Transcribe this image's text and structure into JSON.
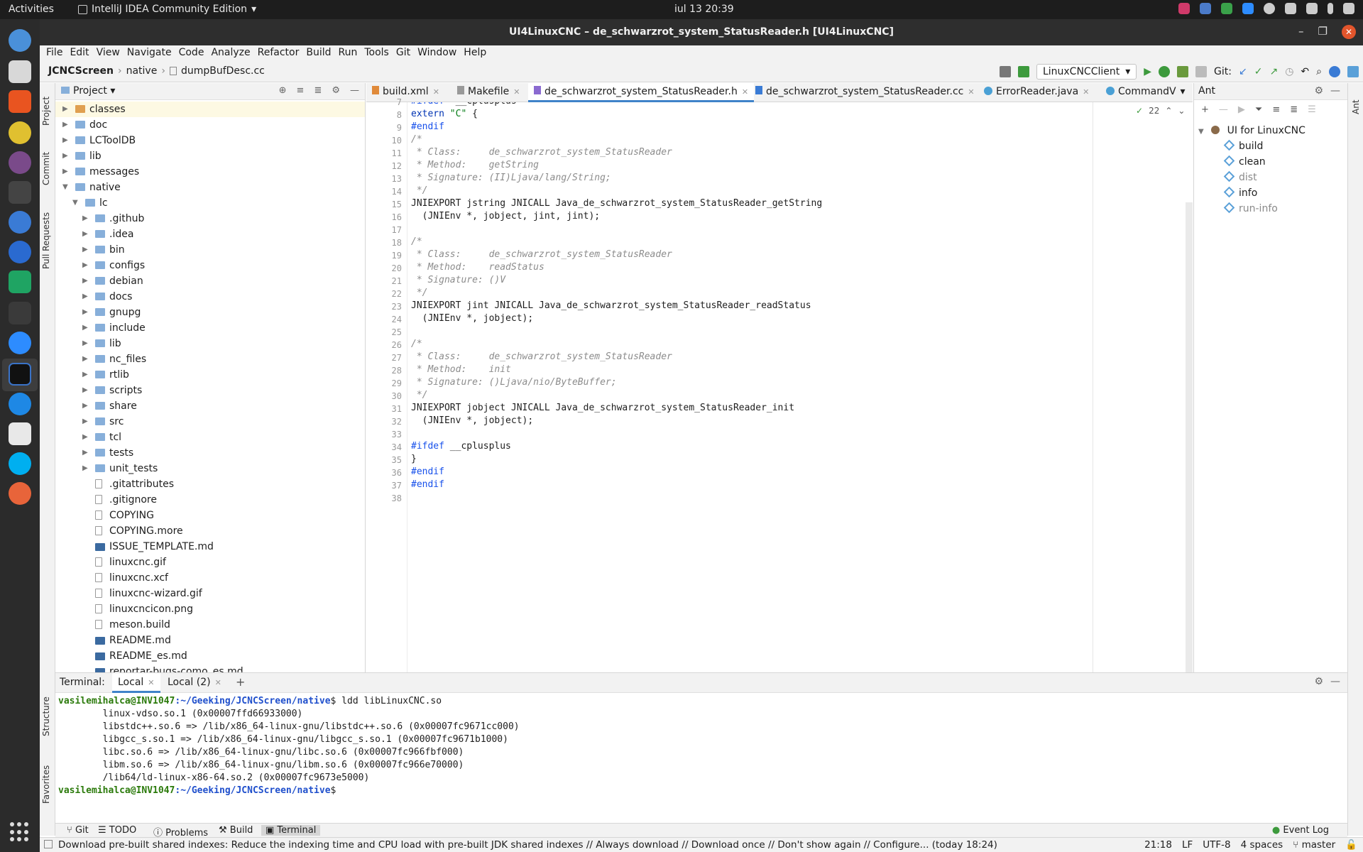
{
  "topbar": {
    "activities": "Activities",
    "app_name": "IntelliJ IDEA Community Edition",
    "clock": "iul 13  20:39"
  },
  "window": {
    "title": "UI4LinuxCNC – de_schwarzrot_system_StatusReader.h [UI4LinuxCNC]"
  },
  "menu": [
    "File",
    "Edit",
    "View",
    "Navigate",
    "Code",
    "Analyze",
    "Refactor",
    "Build",
    "Run",
    "Tools",
    "Git",
    "Window",
    "Help"
  ],
  "breadcrumb": [
    "JCNCScreen",
    "native",
    "dumpBufDesc.cc"
  ],
  "toolbar": {
    "run_config": "LinuxCNCClient",
    "git_label": "Git:"
  },
  "left_strip": [
    "Project",
    "Commit",
    "Pull Requests",
    "Structure",
    "Favorites"
  ],
  "project": {
    "title": "Project",
    "tree": [
      {
        "label": "classes",
        "depth": 1,
        "type": "folder-orange",
        "arrow": "right",
        "selected": true
      },
      {
        "label": "doc",
        "depth": 1,
        "type": "folder",
        "arrow": "right"
      },
      {
        "label": "LCToolDB",
        "depth": 1,
        "type": "folder",
        "arrow": "right"
      },
      {
        "label": "lib",
        "depth": 1,
        "type": "folder",
        "arrow": "right"
      },
      {
        "label": "messages",
        "depth": 1,
        "type": "folder",
        "arrow": "right"
      },
      {
        "label": "native",
        "depth": 1,
        "type": "folder",
        "arrow": "down"
      },
      {
        "label": "lc",
        "depth": 2,
        "type": "folder",
        "arrow": "down"
      },
      {
        "label": ".github",
        "depth": 3,
        "type": "folder",
        "arrow": "right"
      },
      {
        "label": ".idea",
        "depth": 3,
        "type": "folder",
        "arrow": "right"
      },
      {
        "label": "bin",
        "depth": 3,
        "type": "folder",
        "arrow": "right"
      },
      {
        "label": "configs",
        "depth": 3,
        "type": "folder",
        "arrow": "right"
      },
      {
        "label": "debian",
        "depth": 3,
        "type": "folder",
        "arrow": "right"
      },
      {
        "label": "docs",
        "depth": 3,
        "type": "folder",
        "arrow": "right"
      },
      {
        "label": "gnupg",
        "depth": 3,
        "type": "folder",
        "arrow": "right"
      },
      {
        "label": "include",
        "depth": 3,
        "type": "folder",
        "arrow": "right"
      },
      {
        "label": "lib",
        "depth": 3,
        "type": "folder",
        "arrow": "right"
      },
      {
        "label": "nc_files",
        "depth": 3,
        "type": "folder",
        "arrow": "right"
      },
      {
        "label": "rtlib",
        "depth": 3,
        "type": "folder",
        "arrow": "right"
      },
      {
        "label": "scripts",
        "depth": 3,
        "type": "folder",
        "arrow": "right"
      },
      {
        "label": "share",
        "depth": 3,
        "type": "folder",
        "arrow": "right"
      },
      {
        "label": "src",
        "depth": 3,
        "type": "folder",
        "arrow": "right"
      },
      {
        "label": "tcl",
        "depth": 3,
        "type": "folder",
        "arrow": "right"
      },
      {
        "label": "tests",
        "depth": 3,
        "type": "folder",
        "arrow": "right"
      },
      {
        "label": "unit_tests",
        "depth": 3,
        "type": "folder",
        "arrow": "right"
      },
      {
        "label": ".gitattributes",
        "depth": 3,
        "type": "file",
        "arrow": ""
      },
      {
        "label": ".gitignore",
        "depth": 3,
        "type": "file",
        "arrow": ""
      },
      {
        "label": "COPYING",
        "depth": 3,
        "type": "file",
        "arrow": ""
      },
      {
        "label": "COPYING.more",
        "depth": 3,
        "type": "file",
        "arrow": ""
      },
      {
        "label": "ISSUE_TEMPLATE.md",
        "depth": 3,
        "type": "md",
        "arrow": ""
      },
      {
        "label": "linuxcnc.gif",
        "depth": 3,
        "type": "file",
        "arrow": ""
      },
      {
        "label": "linuxcnc.xcf",
        "depth": 3,
        "type": "file",
        "arrow": ""
      },
      {
        "label": "linuxcnc-wizard.gif",
        "depth": 3,
        "type": "file",
        "arrow": ""
      },
      {
        "label": "linuxcncicon.png",
        "depth": 3,
        "type": "file",
        "arrow": ""
      },
      {
        "label": "meson.build",
        "depth": 3,
        "type": "file",
        "arrow": ""
      },
      {
        "label": "README.md",
        "depth": 3,
        "type": "md",
        "arrow": ""
      },
      {
        "label": "README_es.md",
        "depth": 3,
        "type": "md",
        "arrow": ""
      },
      {
        "label": "reportar-bugs-como_es.md",
        "depth": 3,
        "type": "md",
        "arrow": ""
      }
    ]
  },
  "editor": {
    "tabs": [
      {
        "label": "build.xml",
        "active": false
      },
      {
        "label": "Makefile",
        "active": false
      },
      {
        "label": "de_schwarzrot_system_StatusReader.h",
        "active": true
      },
      {
        "label": "de_schwarzrot_system_StatusReader.cc",
        "active": false
      },
      {
        "label": "ErrorReader.java",
        "active": false
      },
      {
        "label": "CommandV",
        "active": false
      }
    ],
    "inspection_count": "22",
    "lines": [
      {
        "n": "7",
        "parts": [
          [
            "pp",
            "#ifdef"
          ],
          [
            "",
            "  __cplusplus"
          ]
        ]
      },
      {
        "n": "8",
        "parts": [
          [
            "kw",
            "extern"
          ],
          [
            "",
            " "
          ],
          [
            "str",
            "\"C\""
          ],
          [
            "",
            " {"
          ]
        ]
      },
      {
        "n": "9",
        "parts": [
          [
            "pp",
            "#endif"
          ]
        ]
      },
      {
        "n": "10",
        "parts": [
          [
            "cm",
            "/*"
          ]
        ]
      },
      {
        "n": "11",
        "parts": [
          [
            "cm",
            " * Class:     de_schwarzrot_system_StatusReader"
          ]
        ]
      },
      {
        "n": "12",
        "parts": [
          [
            "cm",
            " * Method:    getString"
          ]
        ]
      },
      {
        "n": "13",
        "parts": [
          [
            "cm",
            " * Signature: (II)Ljava/lang/String;"
          ]
        ]
      },
      {
        "n": "14",
        "parts": [
          [
            "cm",
            " */"
          ]
        ]
      },
      {
        "n": "15",
        "parts": [
          [
            "",
            "JNIEXPORT jstring JNICALL Java_de_schwarzrot_system_StatusReader_getString"
          ]
        ]
      },
      {
        "n": "16",
        "parts": [
          [
            "",
            "  (JNIEnv *, jobject, jint, jint);"
          ]
        ]
      },
      {
        "n": "17",
        "parts": [
          [
            "",
            ""
          ]
        ]
      },
      {
        "n": "18",
        "parts": [
          [
            "cm",
            "/*"
          ]
        ]
      },
      {
        "n": "19",
        "parts": [
          [
            "cm",
            " * Class:     de_schwarzrot_system_StatusReader"
          ]
        ]
      },
      {
        "n": "20",
        "parts": [
          [
            "cm",
            " * Method:    readStatus"
          ]
        ]
      },
      {
        "n": "21",
        "parts": [
          [
            "cm",
            " * Signature: ()V"
          ]
        ]
      },
      {
        "n": "22",
        "parts": [
          [
            "cm",
            " */"
          ]
        ]
      },
      {
        "n": "23",
        "parts": [
          [
            "",
            "JNIEXPORT jint JNICALL Java_de_schwarzrot_system_StatusReader_readStatus"
          ]
        ]
      },
      {
        "n": "24",
        "parts": [
          [
            "",
            "  (JNIEnv *, jobject);"
          ]
        ]
      },
      {
        "n": "25",
        "parts": [
          [
            "",
            ""
          ]
        ]
      },
      {
        "n": "26",
        "parts": [
          [
            "cm",
            "/*"
          ]
        ]
      },
      {
        "n": "27",
        "parts": [
          [
            "cm",
            " * Class:     de_schwarzrot_system_StatusReader"
          ]
        ]
      },
      {
        "n": "28",
        "parts": [
          [
            "cm",
            " * Method:    init"
          ]
        ]
      },
      {
        "n": "29",
        "parts": [
          [
            "cm",
            " * Signature: ()Ljava/nio/ByteBuffer;"
          ]
        ]
      },
      {
        "n": "30",
        "parts": [
          [
            "cm",
            " */"
          ]
        ]
      },
      {
        "n": "31",
        "parts": [
          [
            "",
            "JNIEXPORT jobject JNICALL Java_de_schwarzrot_system_StatusReader_init"
          ]
        ]
      },
      {
        "n": "32",
        "parts": [
          [
            "",
            "  (JNIEnv *, jobject);"
          ]
        ]
      },
      {
        "n": "33",
        "parts": [
          [
            "",
            ""
          ]
        ]
      },
      {
        "n": "34",
        "parts": [
          [
            "pp",
            "#ifdef"
          ],
          [
            "",
            " __cplusplus"
          ]
        ]
      },
      {
        "n": "35",
        "parts": [
          [
            "",
            "}"
          ]
        ]
      },
      {
        "n": "36",
        "parts": [
          [
            "pp",
            "#endif"
          ]
        ]
      },
      {
        "n": "37",
        "parts": [
          [
            "pp",
            "#endif"
          ]
        ]
      },
      {
        "n": "38",
        "parts": [
          [
            "",
            ""
          ]
        ]
      }
    ]
  },
  "ant": {
    "title": "Ant",
    "root": "UI for LinuxCNC",
    "targets": [
      {
        "label": "build",
        "enabled": true
      },
      {
        "label": "clean",
        "enabled": true
      },
      {
        "label": "dist",
        "enabled": false
      },
      {
        "label": "info",
        "enabled": true
      },
      {
        "label": "run-info",
        "enabled": false
      }
    ],
    "strip_label": "Ant"
  },
  "terminal": {
    "title": "Terminal:",
    "tabs": [
      "Local",
      "Local (2)"
    ],
    "prompt_user": "vasilemihalca@INV1047",
    "prompt_path": ":~/Geeking/JCNCScreen/native",
    "command": "$ ldd libLinuxCNC.so",
    "output": [
      "        linux-vdso.so.1 (0x00007ffd66933000)",
      "        libstdc++.so.6 => /lib/x86_64-linux-gnu/libstdc++.so.6 (0x00007fc9671cc000)",
      "        libgcc_s.so.1 => /lib/x86_64-linux-gnu/libgcc_s.so.1 (0x00007fc9671b1000)",
      "        libc.so.6 => /lib/x86_64-linux-gnu/libc.so.6 (0x00007fc966fbf000)",
      "        libm.so.6 => /lib/x86_64-linux-gnu/libm.so.6 (0x00007fc966e70000)",
      "        /lib64/ld-linux-x86-64.so.2 (0x00007fc9673e5000)"
    ],
    "last_prompt_suffix": "$"
  },
  "bottom_tools": [
    {
      "label": "Git",
      "active": false
    },
    {
      "label": "TODO",
      "active": false
    },
    {
      "label": "Problems",
      "active": false
    },
    {
      "label": "Build",
      "active": false
    },
    {
      "label": "Terminal",
      "active": true
    }
  ],
  "event_log": "Event Log",
  "status": {
    "message": "Download pre-built shared indexes: Reduce the indexing time and CPU load with pre-built JDK shared indexes // Always download // Download once // Don't show again // Configure... (today 18:24)",
    "position": "21:18",
    "line_sep": "LF",
    "encoding": "UTF-8",
    "indent": "4 spaces",
    "branch": "master"
  }
}
